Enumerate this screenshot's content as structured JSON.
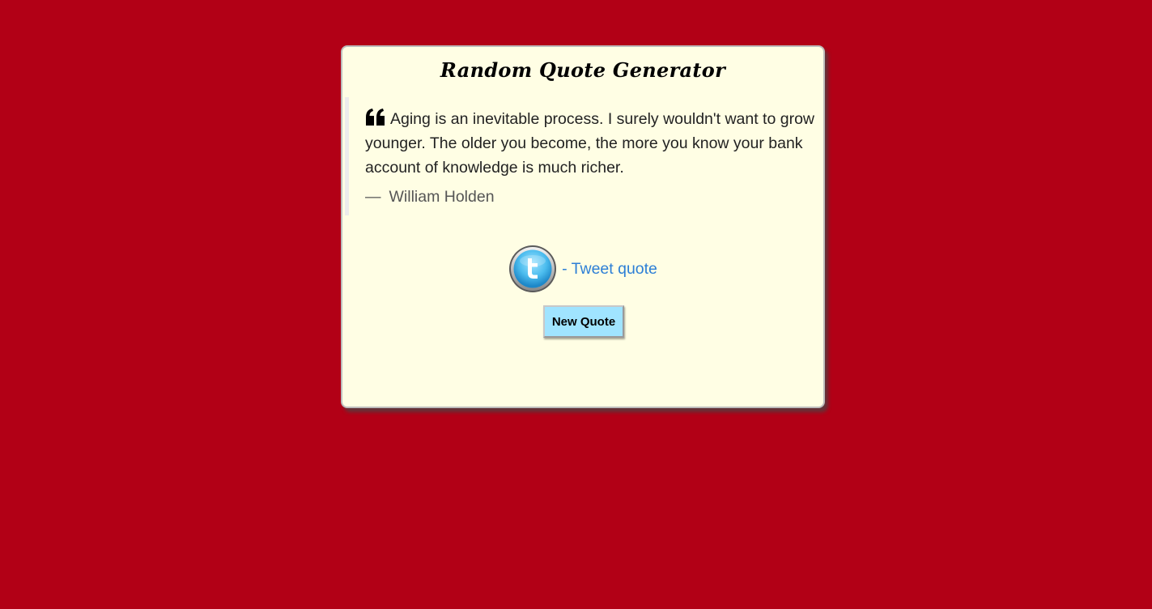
{
  "app": {
    "title": "Random Quote Generator"
  },
  "quote": {
    "text": "Aging is an inevitable process. I surely wouldn't want to grow younger. The older you become, the more you know your bank account of knowledge is much richer.",
    "author": "William Holden",
    "author_dash": "—",
    "icon": "quote-left-icon"
  },
  "tweet": {
    "label": "- Tweet quote",
    "icon": "twitter-icon"
  },
  "actions": {
    "new_quote_label": "New Quote"
  },
  "colors": {
    "background": "#b20016",
    "card": "#fffee4",
    "link": "#2d7fd6",
    "button": "#a0e4ff"
  }
}
